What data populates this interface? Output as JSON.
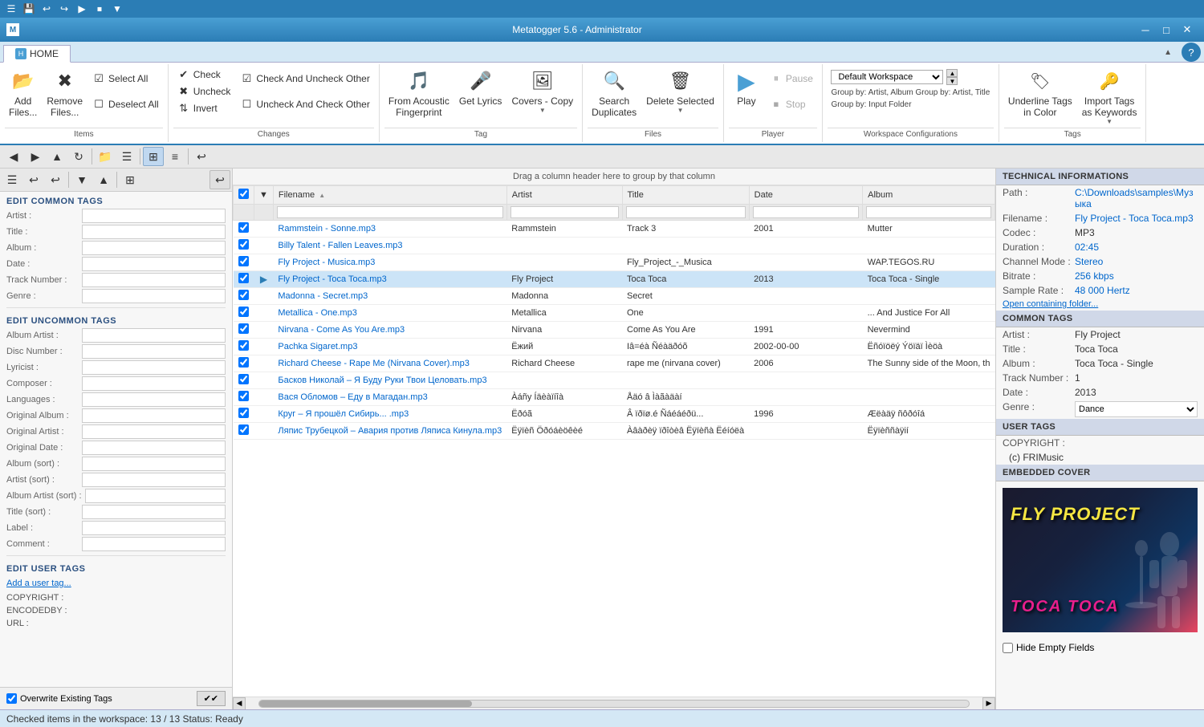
{
  "app": {
    "title": "Metatogger 5.6 - Administrator",
    "minimize": "─",
    "maximize": "□",
    "close": "✕"
  },
  "quick_access": {
    "buttons": [
      "☰",
      "💾",
      "↩",
      "↪",
      "▶",
      "⏹",
      "▼"
    ]
  },
  "ribbon_tabs": [
    {
      "id": "tab-home",
      "label": "HOME",
      "active": true
    }
  ],
  "ribbon": {
    "groups": [
      {
        "id": "items",
        "label": "Items",
        "buttons_large": [
          {
            "id": "add-files",
            "icon": "📂",
            "label": "Add\nFiles..."
          },
          {
            "id": "remove-files",
            "icon": "✖",
            "label": "Remove\nFiles..."
          }
        ],
        "buttons_sm": [
          {
            "id": "select-all",
            "icon": "☑",
            "label": "Select All"
          },
          {
            "id": "deselect-all",
            "icon": "☐",
            "label": "Deselect All"
          }
        ]
      },
      {
        "id": "changes",
        "label": "Changes",
        "buttons_sm": [
          {
            "id": "check",
            "icon": "✔",
            "label": "Check"
          },
          {
            "id": "uncheck",
            "icon": "✖",
            "label": "Uncheck"
          },
          {
            "id": "invert",
            "icon": "⇅",
            "label": "Invert"
          },
          {
            "id": "check-uncheck-other",
            "icon": "✔",
            "label": "Check And Uncheck Other"
          },
          {
            "id": "uncheck-check-other",
            "icon": "✖",
            "label": "Uncheck And Check Other"
          }
        ]
      },
      {
        "id": "tag",
        "label": "Tag",
        "buttons_large": [
          {
            "id": "from-acoustic",
            "icon": "🎵",
            "label": "From Acoustic\nFingerprint"
          },
          {
            "id": "get-lyrics",
            "icon": "🎤",
            "label": "Get Lyrics"
          },
          {
            "id": "copy-covers",
            "icon": "🖼",
            "label": "Copy\nCovers ▾"
          }
        ]
      },
      {
        "id": "files",
        "label": "Files",
        "buttons_large": [
          {
            "id": "search-duplicates",
            "icon": "🔍",
            "label": "Search\nDuplicates"
          },
          {
            "id": "delete-selected",
            "icon": "🗑",
            "label": "Delete\nSelected ▾"
          }
        ]
      },
      {
        "id": "player",
        "label": "Player",
        "buttons_large": [
          {
            "id": "play",
            "icon": "▶",
            "label": "Play"
          },
          {
            "id": "stop",
            "icon": "⏹",
            "label": "Stop"
          },
          {
            "id": "pause",
            "icon": "⏸",
            "label": "Pause"
          }
        ]
      },
      {
        "id": "workspace",
        "label": "Workspace Configurations",
        "workspace_name": "Default Workspace",
        "group_by_1": "Group by: Artist, Album  Group by: Artist, Title",
        "group_by_2": "Group by: Input Folder"
      },
      {
        "id": "tags-group",
        "label": "Tags",
        "buttons_large": [
          {
            "id": "underline-tags",
            "icon": "🏷",
            "label": "Underline Tags\nin Color"
          },
          {
            "id": "import-tags",
            "icon": "🔑",
            "label": "Import Tags\nas Keywords ▾"
          }
        ]
      }
    ]
  },
  "nav_toolbar": {
    "buttons": [
      {
        "id": "nav-back",
        "icon": "◀",
        "active": false
      },
      {
        "id": "nav-forward",
        "icon": "▶",
        "active": false
      },
      {
        "id": "nav-up",
        "icon": "▲",
        "active": false
      },
      {
        "id": "nav-refresh",
        "icon": "↻",
        "active": false
      },
      {
        "id": "nav-folder",
        "icon": "📁",
        "active": false
      },
      {
        "id": "nav-filter",
        "icon": "☰",
        "active": false
      },
      {
        "id": "nav-view1",
        "icon": "⊞",
        "active": false
      },
      {
        "id": "nav-view2",
        "icon": "≡",
        "active": false
      },
      {
        "id": "nav-undo",
        "icon": "↩",
        "active": false
      }
    ]
  },
  "left_panel": {
    "common_tags_header": "EDIT COMMON TAGS",
    "common_tags": [
      {
        "id": "artist",
        "label": "Artist :",
        "value": ""
      },
      {
        "id": "title",
        "label": "Title :",
        "value": ""
      },
      {
        "id": "album",
        "label": "Album :",
        "value": ""
      },
      {
        "id": "date",
        "label": "Date :",
        "value": ""
      },
      {
        "id": "track-number",
        "label": "Track Number :",
        "value": ""
      },
      {
        "id": "genre",
        "label": "Genre :",
        "value": ""
      }
    ],
    "uncommon_tags_header": "EDIT UNCOMMON TAGS",
    "uncommon_tags": [
      {
        "id": "album-artist",
        "label": "Album Artist :",
        "value": ""
      },
      {
        "id": "disc-number",
        "label": "Disc Number :",
        "value": ""
      },
      {
        "id": "lyricist",
        "label": "Lyricist :",
        "value": ""
      },
      {
        "id": "composer",
        "label": "Composer :",
        "value": ""
      },
      {
        "id": "languages",
        "label": "Languages :",
        "value": ""
      },
      {
        "id": "original-album",
        "label": "Original Album :",
        "value": ""
      },
      {
        "id": "original-artist",
        "label": "Original Artist :",
        "value": ""
      },
      {
        "id": "original-date",
        "label": "Original Date :",
        "value": ""
      },
      {
        "id": "album-sort",
        "label": "Album (sort) :",
        "value": ""
      },
      {
        "id": "artist-sort",
        "label": "Artist (sort) :",
        "value": ""
      },
      {
        "id": "album-artist-sort",
        "label": "Album Artist (sort) :",
        "value": ""
      },
      {
        "id": "title-sort",
        "label": "Title (sort) :",
        "value": ""
      },
      {
        "id": "label",
        "label": "Label :",
        "value": ""
      },
      {
        "id": "comment",
        "label": "Comment :",
        "value": ""
      }
    ],
    "user_tags_header": "EDIT USER TAGS",
    "add_user_tag": "Add a user tag...",
    "user_tags": [
      {
        "label": "COPYRIGHT :",
        "value": ""
      },
      {
        "label": "ENCODEDBY :",
        "value": ""
      },
      {
        "label": "URL :",
        "value": ""
      }
    ],
    "overwrite_label": "Overwrite Existing Tags"
  },
  "center_panel": {
    "drag_hint": "Drag a column header here to group by that column",
    "table_headers": [
      "Filename",
      "Artist",
      "Title",
      "Date",
      "Album"
    ],
    "files": [
      {
        "id": 1,
        "checked": true,
        "selected": false,
        "filename": "Rammstein - Sonne.mp3",
        "artist": "Rammstein",
        "title": "Track  3",
        "date": "2001",
        "album": "Mutter"
      },
      {
        "id": 2,
        "checked": true,
        "selected": false,
        "filename": "Billy Talent - Fallen Leaves.mp3",
        "artist": "",
        "title": "",
        "date": "",
        "album": ""
      },
      {
        "id": 3,
        "checked": true,
        "selected": false,
        "filename": "Fly Project - Musica.mp3",
        "artist": "",
        "title": "Fly_Project_-_Musica",
        "date": "",
        "album": "WAP.TEGOS.RU"
      },
      {
        "id": 4,
        "checked": true,
        "selected": true,
        "filename": "Fly Project - Toca Toca.mp3",
        "artist": "Fly Project",
        "title": "Toca Toca",
        "date": "2013",
        "album": "Toca Toca - Single"
      },
      {
        "id": 5,
        "checked": true,
        "selected": false,
        "filename": "Madonna - Secret.mp3",
        "artist": "Madonna",
        "title": "Secret",
        "date": "",
        "album": ""
      },
      {
        "id": 6,
        "checked": true,
        "selected": false,
        "filename": "Metallica - One.mp3",
        "artist": "Metallica",
        "title": "One",
        "date": "",
        "album": "... And Justice For All"
      },
      {
        "id": 7,
        "checked": true,
        "selected": false,
        "filename": "Nirvana - Come As You Are.mp3",
        "artist": "Nirvana",
        "title": "Come As You Are",
        "date": "1991",
        "album": "Nevermind"
      },
      {
        "id": 8,
        "checked": true,
        "selected": false,
        "filename": "Pachka Sigaret.mp3",
        "artist": "Ёжий",
        "title": "Iâ=éà Ñéàäðóõ",
        "date": "2002-00-00",
        "album": "Ëñóïöёý Ýöïäï Ìèöà"
      },
      {
        "id": 9,
        "checked": true,
        "selected": false,
        "filename": "Richard Cheese - Rape Me (Nirvana Cover).mp3",
        "artist": "Richard Cheese",
        "title": "rape me (nirvana cover)",
        "date": "2006",
        "album": "The Sunny side of the Moon, th"
      },
      {
        "id": 10,
        "checked": true,
        "selected": false,
        "filename": "Басков Николай – Я Буду Руки Твои Целовать.mp3",
        "artist": "",
        "title": "",
        "date": "",
        "album": ""
      },
      {
        "id": 11,
        "checked": true,
        "selected": false,
        "filename": "Вася Обломов – Еду в Магадан.mp3",
        "artist": "Àáñy Íäèàïíîà",
        "title": "Åäó â Ìàãàäàí",
        "date": "",
        "album": ""
      },
      {
        "id": 12,
        "checked": true,
        "selected": false,
        "filename": "Круг – Я прошёл Сибирь... .mp3",
        "artist": "Ëðóã",
        "title": "Â ïðïø.é Ñáéáéðü...",
        "date": "1996",
        "album": "Æëàäÿ ñôðóîá"
      },
      {
        "id": 13,
        "checked": true,
        "selected": false,
        "filename": "Ляпис Трубецкой – Авария против Ляписа Кинула.mp3",
        "artist": "Ëÿïèñ Öðóáèöêèé",
        "title": "Àâàðèÿ ïðîòèâ Ëÿïèñà Ëéíóëà",
        "date": "",
        "album": "Ëÿïèññàÿií"
      }
    ],
    "status": "Checked items in the workspace: 13 / 13   Status: Ready"
  },
  "right_panel": {
    "technical_header": "TECHNICAL INFORMATIONS",
    "technical": {
      "path_label": "Path :",
      "path_value": "C:\\Downloads\\samples\\Музыка",
      "filename_label": "Filename :",
      "filename_value": "Fly Project - Toca Toca.mp3",
      "codec_label": "Codec :",
      "codec_value": "MP3",
      "duration_label": "Duration :",
      "duration_value": "02:45",
      "channel_label": "Channel Mode :",
      "channel_value": "Stereo",
      "bitrate_label": "Bitrate :",
      "bitrate_value": "256 kbps",
      "samplerate_label": "Sample Rate :",
      "samplerate_value": "48 000 Hertz",
      "open_folder_link": "Open containing folder..."
    },
    "common_tags_header": "COMMON TAGS",
    "common_tags": {
      "artist_label": "Artist :",
      "artist_value": "Fly Project",
      "title_label": "Title :",
      "title_value": "Toca Toca",
      "album_label": "Album :",
      "album_value": "Toca Toca - Single",
      "track_label": "Track Number :",
      "track_value": "1",
      "date_label": "Date :",
      "date_value": "2013",
      "genre_label": "Genre :",
      "genre_value": "Dance"
    },
    "user_tags_header": "USER TAGS",
    "user_tags": {
      "copyright_label": "COPYRIGHT :",
      "copyright_value": "(c) FRIMusic"
    },
    "embedded_cover_header": "EMBEDDED COVER",
    "cover_artist": "FLY PROJECT",
    "cover_title": "TOCA TOCA",
    "hide_empty_label": "Hide Empty Fields"
  }
}
